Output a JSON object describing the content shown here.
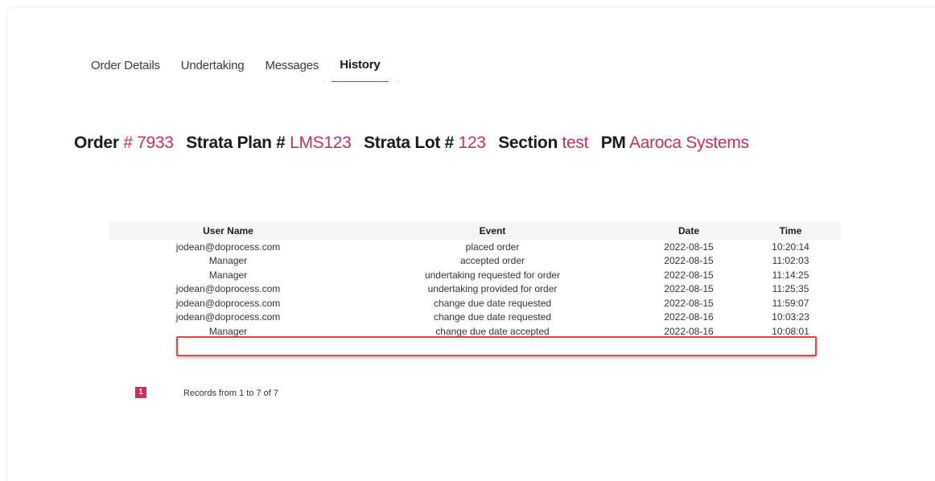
{
  "tabs": [
    {
      "label": "Order Details"
    },
    {
      "label": "Undertaking"
    },
    {
      "label": "Messages"
    },
    {
      "label": "History",
      "active": true
    }
  ],
  "order_info": {
    "order_label": "Order",
    "order_value": "# 7933",
    "plan_label": "Strata Plan #",
    "plan_value": "LMS123",
    "lot_label": "Strata Lot #",
    "lot_value": "123",
    "section_label": "Section",
    "section_value": "test",
    "pm_label": "PM",
    "pm_value": "Aaroca Systems"
  },
  "history_table": {
    "headers": {
      "user": "User Name",
      "event": "Event",
      "date": "Date",
      "time": "Time"
    },
    "rows": [
      {
        "user": "jodean@doprocess.com",
        "event": "placed order",
        "date": "2022-08-15",
        "time": "10:20:14"
      },
      {
        "user": "Manager",
        "event": "accepted order",
        "date": "2022-08-15",
        "time": "11:02:03"
      },
      {
        "user": "Manager",
        "event": "undertaking requested for order",
        "date": "2022-08-15",
        "time": "11:14:25"
      },
      {
        "user": "jodean@doprocess.com",
        "event": "undertaking provided for order",
        "date": "2022-08-15",
        "time": "11:25:35"
      },
      {
        "user": "jodean@doprocess.com",
        "event": "change due date requested",
        "date": "2022-08-15",
        "time": "11:59:07"
      },
      {
        "user": "jodean@doprocess.com",
        "event": "change due date requested",
        "date": "2022-08-16",
        "time": "10:03:23"
      },
      {
        "user": "Manager",
        "event": "change due date accepted",
        "date": "2022-08-16",
        "time": "10:08:01"
      }
    ]
  },
  "pagination": {
    "current_page": "1",
    "records_text": "Records from 1 to 7 of 7"
  },
  "colors": {
    "accent": "#c0335f",
    "highlight_border": "#e0454e"
  }
}
